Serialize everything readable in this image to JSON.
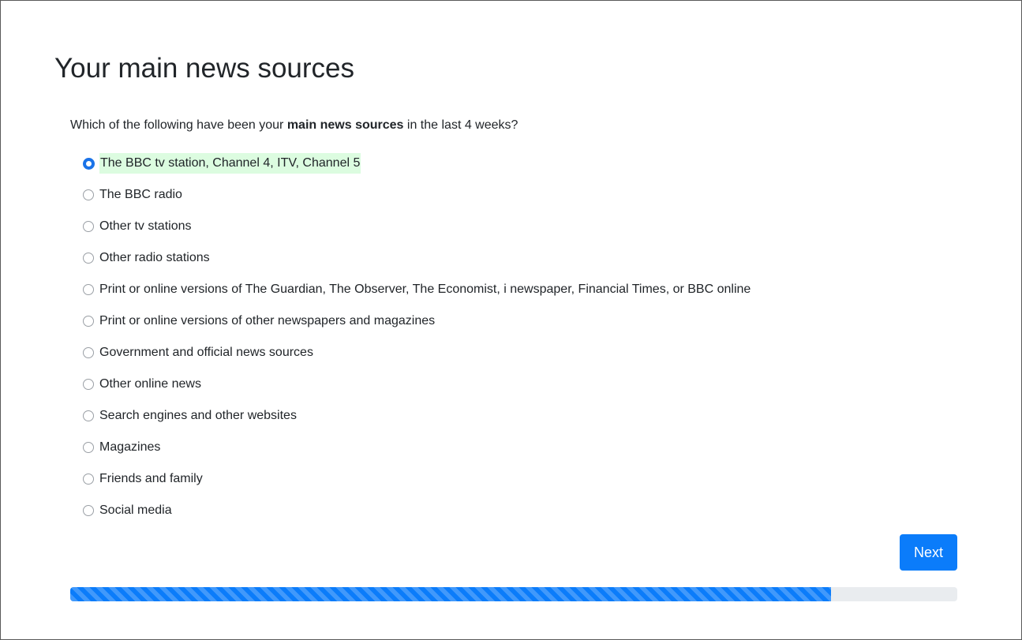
{
  "page": {
    "title": "Your main news sources",
    "question": {
      "prefix": "Which of the following have been your ",
      "bold": "main news sources",
      "suffix": " in the last 4 weeks?"
    }
  },
  "options": [
    {
      "label": "The BBC tv station, Channel 4, ITV, Channel 5",
      "selected": true
    },
    {
      "label": "The BBC radio",
      "selected": false
    },
    {
      "label": "Other tv stations",
      "selected": false
    },
    {
      "label": "Other radio stations",
      "selected": false
    },
    {
      "label": "Print or online versions of The Guardian, The Observer, The Economist, i newspaper, Financial Times, or BBC online",
      "selected": false
    },
    {
      "label": "Print or online versions of other newspapers and magazines",
      "selected": false
    },
    {
      "label": "Government and official news sources",
      "selected": false
    },
    {
      "label": "Other online news",
      "selected": false
    },
    {
      "label": "Search engines and other websites",
      "selected": false
    },
    {
      "label": "Magazines",
      "selected": false
    },
    {
      "label": "Friends and family",
      "selected": false
    },
    {
      "label": "Social media",
      "selected": false
    }
  ],
  "next_button": {
    "label": "Next"
  },
  "progress": {
    "fraction": 0.858
  },
  "colors": {
    "accent": "#0b7cfa",
    "selected_highlight": "#dcfce0",
    "progress_track": "#e9ecef"
  }
}
